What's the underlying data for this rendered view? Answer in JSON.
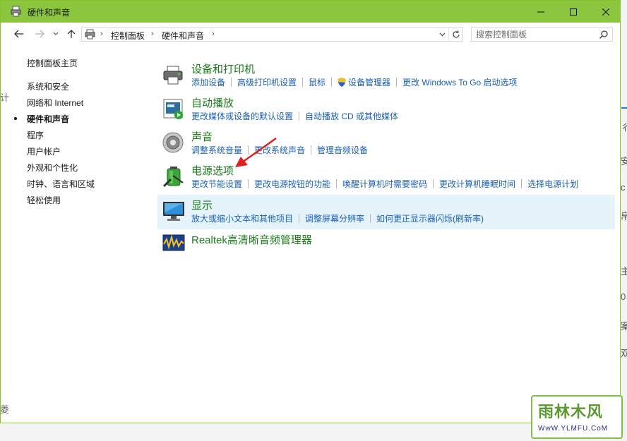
{
  "window": {
    "title": "硬件和声音",
    "accent": "#8cc63f"
  },
  "nav": {
    "breadcrumb": [
      "控制面板",
      "硬件和声音"
    ],
    "search_placeholder": "搜索控制面板"
  },
  "sidebar": {
    "items": [
      {
        "label": "控制面板主页"
      },
      {
        "label": "系统和安全"
      },
      {
        "label": "网络和 Internet"
      },
      {
        "label": "硬件和声音",
        "active": true
      },
      {
        "label": "程序"
      },
      {
        "label": "用户帐户"
      },
      {
        "label": "外观和个性化"
      },
      {
        "label": "时钟、语言和区域"
      },
      {
        "label": "轻松使用"
      }
    ]
  },
  "categories": [
    {
      "title": "设备和打印机",
      "icon": "printer-icon",
      "links": [
        "添加设备",
        "高级打印机设置",
        "鼠标",
        "设备管理器",
        "更改 Windows To Go 启动选项"
      ]
    },
    {
      "title": "自动播放",
      "icon": "autoplay-icon",
      "links": [
        "更改媒体或设备的默认设置",
        "自动播放 CD 或其他媒体"
      ]
    },
    {
      "title": "声音",
      "icon": "speaker-icon",
      "links": [
        "调整系统音量",
        "更改系统声音",
        "管理音频设备"
      ]
    },
    {
      "title": "电源选项",
      "icon": "battery-icon",
      "links": [
        "更改节能设置",
        "更改电源按钮的功能",
        "唤醒计算机时需要密码",
        "更改计算机睡眠时间",
        "选择电源计划"
      ]
    },
    {
      "title": "显示",
      "icon": "monitor-icon",
      "highlighted": true,
      "links": [
        "放大或缩小文本和其他项目",
        "调整屏幕分辨率",
        "如何更正显示器闪烁(刷新率)"
      ]
    },
    {
      "title": "Realtek高清晰音频管理器",
      "icon": "realtek-audio-icon",
      "links": []
    }
  ],
  "watermark": {
    "logo": "雨林木风",
    "url": "WwW.YLMFU.CoM"
  },
  "background_fragments": {
    "right": [
      "彳",
      "安",
      "с",
      "帛",
      "主",
      "0",
      "案",
      "双"
    ],
    "left": [
      "计",
      "菱"
    ]
  }
}
